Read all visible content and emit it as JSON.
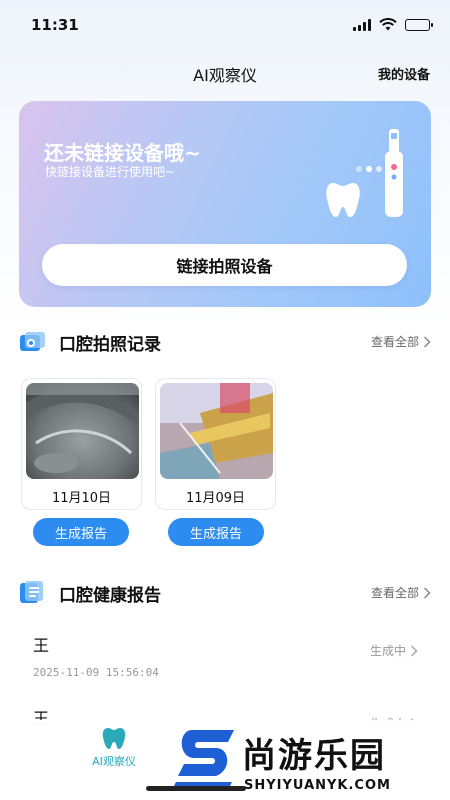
{
  "status_bar": {
    "time": "11:31"
  },
  "nav": {
    "title": "AI观察仪",
    "right_link": "我的设备"
  },
  "banner": {
    "title": "还未链接设备哦~",
    "subtitle": "快链接设备进行使用吧~",
    "button": "链接拍照设备"
  },
  "photo_section": {
    "title": "口腔拍照记录",
    "more": "查看全部",
    "items": [
      {
        "date": "11月10日",
        "action": "生成报告"
      },
      {
        "date": "11月09日",
        "action": "生成报告"
      }
    ]
  },
  "report_section": {
    "title": "口腔健康报告",
    "more": "查看全部",
    "items": [
      {
        "name": "王",
        "time": "2025-11-09 15:56:04",
        "status": "生成中"
      },
      {
        "name": "王",
        "status": "生成中"
      }
    ]
  },
  "tab_bar": {
    "active_label": "AI观察仪"
  },
  "watermark": {
    "text": "尚游乐园",
    "url": "SHYIYUANYK.COM"
  },
  "colors": {
    "accent": "#2d8cf0",
    "tab_active": "#2aa9b8"
  }
}
